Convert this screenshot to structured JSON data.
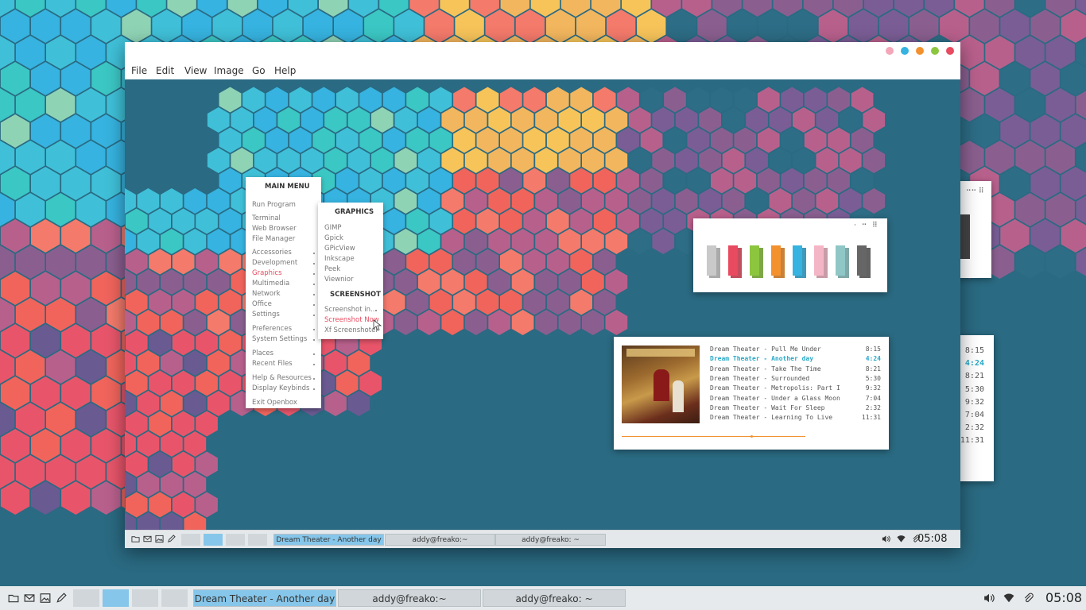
{
  "colors": {
    "accent": "#e84a5f",
    "active_task": "#86c6ea",
    "now_playing": "#2aa9c8",
    "desktop": "#2a6a82"
  },
  "window": {
    "title_buttons": [
      {
        "name": "pink",
        "color": "#f4a7b9"
      },
      {
        "name": "blue",
        "color": "#36b3e0"
      },
      {
        "name": "orange",
        "color": "#f3912e"
      },
      {
        "name": "green",
        "color": "#8cc63f"
      },
      {
        "name": "red",
        "color": "#e84a5f"
      }
    ],
    "menubar": [
      "File",
      "Edit",
      "View",
      "Image",
      "Go",
      "Help"
    ]
  },
  "main_menu": {
    "title": "MAIN MENU",
    "items": [
      {
        "label": "Run Program",
        "submenu": false
      },
      {
        "label": "Terminal",
        "submenu": false
      },
      {
        "label": "Web Browser",
        "submenu": false
      },
      {
        "label": "File Manager",
        "submenu": false
      },
      {
        "label": "Accessories",
        "submenu": true
      },
      {
        "label": "Development",
        "submenu": true
      },
      {
        "label": "Graphics",
        "submenu": true,
        "active": true
      },
      {
        "label": "Multimedia",
        "submenu": true
      },
      {
        "label": "Network",
        "submenu": true
      },
      {
        "label": "Office",
        "submenu": true
      },
      {
        "label": "Settings",
        "submenu": true
      },
      {
        "label": "Preferences",
        "submenu": true
      },
      {
        "label": "System Settings",
        "submenu": true
      },
      {
        "label": "Places",
        "submenu": true
      },
      {
        "label": "Recent Files",
        "submenu": true
      },
      {
        "label": "Help & Resources",
        "submenu": true
      },
      {
        "label": "Display Keybinds",
        "submenu": true
      },
      {
        "label": "Exit Openbox",
        "submenu": false
      }
    ]
  },
  "graphics_menu": {
    "title": "GRAPHICS",
    "items": [
      "GIMP",
      "Gpick",
      "GPicView",
      "Inkscape",
      "Peek",
      "Viewnior"
    ],
    "section2_title": "SCREENSHOT",
    "section2_items": [
      {
        "label": "Screenshot in..",
        "submenu": true
      },
      {
        "label": "Screenshot Now",
        "active": true
      },
      {
        "label": "Xf Screenshoter"
      }
    ]
  },
  "palette": {
    "swatches": [
      "#c9c9c9",
      "#e84a5f",
      "#8cc63f",
      "#f3912e",
      "#36b3e0",
      "#f4b6c6",
      "#8fc7c7",
      "#666666"
    ]
  },
  "music": {
    "tracks": [
      {
        "title": "Dream Theater - Pull Me Under",
        "duration": "8:15"
      },
      {
        "title": "Dream Theater - Another day",
        "duration": "4:24",
        "current": true
      },
      {
        "title": "Dream Theater - Take The Time",
        "duration": "8:21"
      },
      {
        "title": "Dream Theater - Surrounded",
        "duration": "5:30"
      },
      {
        "title": "Dream Theater - Metropolis: Part I",
        "duration": "9:32"
      },
      {
        "title": "Dream Theater - Under a Glass Moon",
        "duration": "7:04"
      },
      {
        "title": "Dream Theater - Wait For Sleep",
        "duration": "2:32"
      },
      {
        "title": "Dream Theater - Learning To Live",
        "duration": "11:31"
      }
    ],
    "progress": 0.7
  },
  "taskbar": {
    "launchers": [
      "folder-icon",
      "mail-icon",
      "image-icon",
      "pen-icon"
    ],
    "workspaces": [
      {
        "active": false
      },
      {
        "active": true
      },
      {
        "active": false
      },
      {
        "active": false
      }
    ],
    "tasks": [
      {
        "label": "Dream Theater - Another day",
        "active": true
      },
      {
        "label": "addy@freako:~",
        "active": false
      },
      {
        "label": "addy@freako: ~",
        "active": false
      }
    ],
    "tray": [
      "volume-icon",
      "wifi-icon",
      "paperclip-icon"
    ],
    "clock": "05:08"
  }
}
